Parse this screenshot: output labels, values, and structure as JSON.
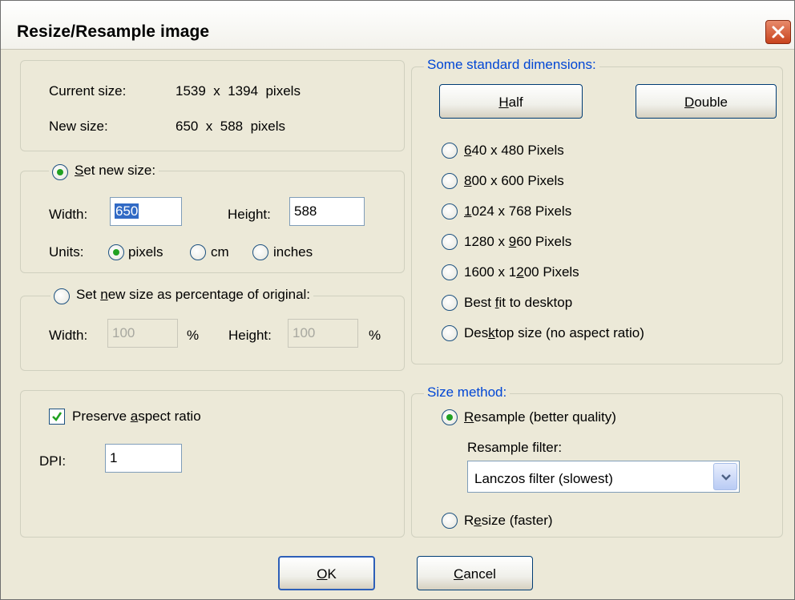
{
  "dialog": {
    "title": "Resize/Resample image",
    "close_label": "close"
  },
  "info": {
    "current_label": "Current size:",
    "current_value": "1539  x  1394  pixels",
    "new_label": "New size:",
    "new_value": "650  x  588  pixels"
  },
  "set_size": {
    "title_prefix": "",
    "title_mnemonic": "S",
    "title_rest": "et new size:",
    "width_label": "Width:",
    "width_value": "650",
    "height_label": "Height:",
    "height_value": "588",
    "units_label": "Units:",
    "unit_pixels": "pixels",
    "unit_cm": "cm",
    "unit_inches": "inches"
  },
  "percentage": {
    "title_prefix": "Set ",
    "title_mnemonic": "n",
    "title_rest": "ew size as percentage of original:",
    "width_label": "Width:",
    "width_value": "100",
    "width_unit": "%",
    "height_label": "Height:",
    "height_value": "100",
    "height_unit": "%"
  },
  "aspect": {
    "checkbox_prefix": "Preserve ",
    "checkbox_mnemonic": "a",
    "checkbox_rest": "spect ratio",
    "dpi_label": "DPI:",
    "dpi_value": "1"
  },
  "standard": {
    "title": "Some standard dimensions:",
    "half_prefix": "",
    "half_mnemonic": "H",
    "half_rest": "alf",
    "double_prefix": "",
    "double_mnemonic": "D",
    "double_rest": "ouble",
    "options": [
      {
        "pre": "",
        "mn": "6",
        "post": "40 x 480 Pixels"
      },
      {
        "pre": "",
        "mn": "8",
        "post": "00 x 600 Pixels"
      },
      {
        "pre": "",
        "mn": "1",
        "post": "024 x 768 Pixels"
      },
      {
        "pre": "1280 x ",
        "mn": "9",
        "post": "60 Pixels"
      },
      {
        "pre": "1600 x 1",
        "mn": "2",
        "post": "00 Pixels"
      },
      {
        "pre": "Best ",
        "mn": "f",
        "post": "it to desktop"
      },
      {
        "pre": "Des",
        "mn": "k",
        "post": "top size (no aspect ratio)"
      }
    ]
  },
  "method": {
    "title": "Size method:",
    "resample_prefix": "",
    "resample_mnemonic": "R",
    "resample_rest": "esample (better quality)",
    "filter_label": "Resample filter:",
    "filter_value": "Lanczos filter (slowest)",
    "resize_prefix": "R",
    "resize_mnemonic": "e",
    "resize_rest": "size (faster)"
  },
  "buttons": {
    "ok_prefix": "",
    "ok_mnemonic": "O",
    "ok_rest": "K",
    "cancel_prefix": "",
    "cancel_mnemonic": "C",
    "cancel_rest": "ancel"
  },
  "colors": {
    "face": "#ece9d8",
    "group_title_blue": "#0046d5",
    "radio_dot": "#21a121",
    "button_border": "#003c74"
  }
}
